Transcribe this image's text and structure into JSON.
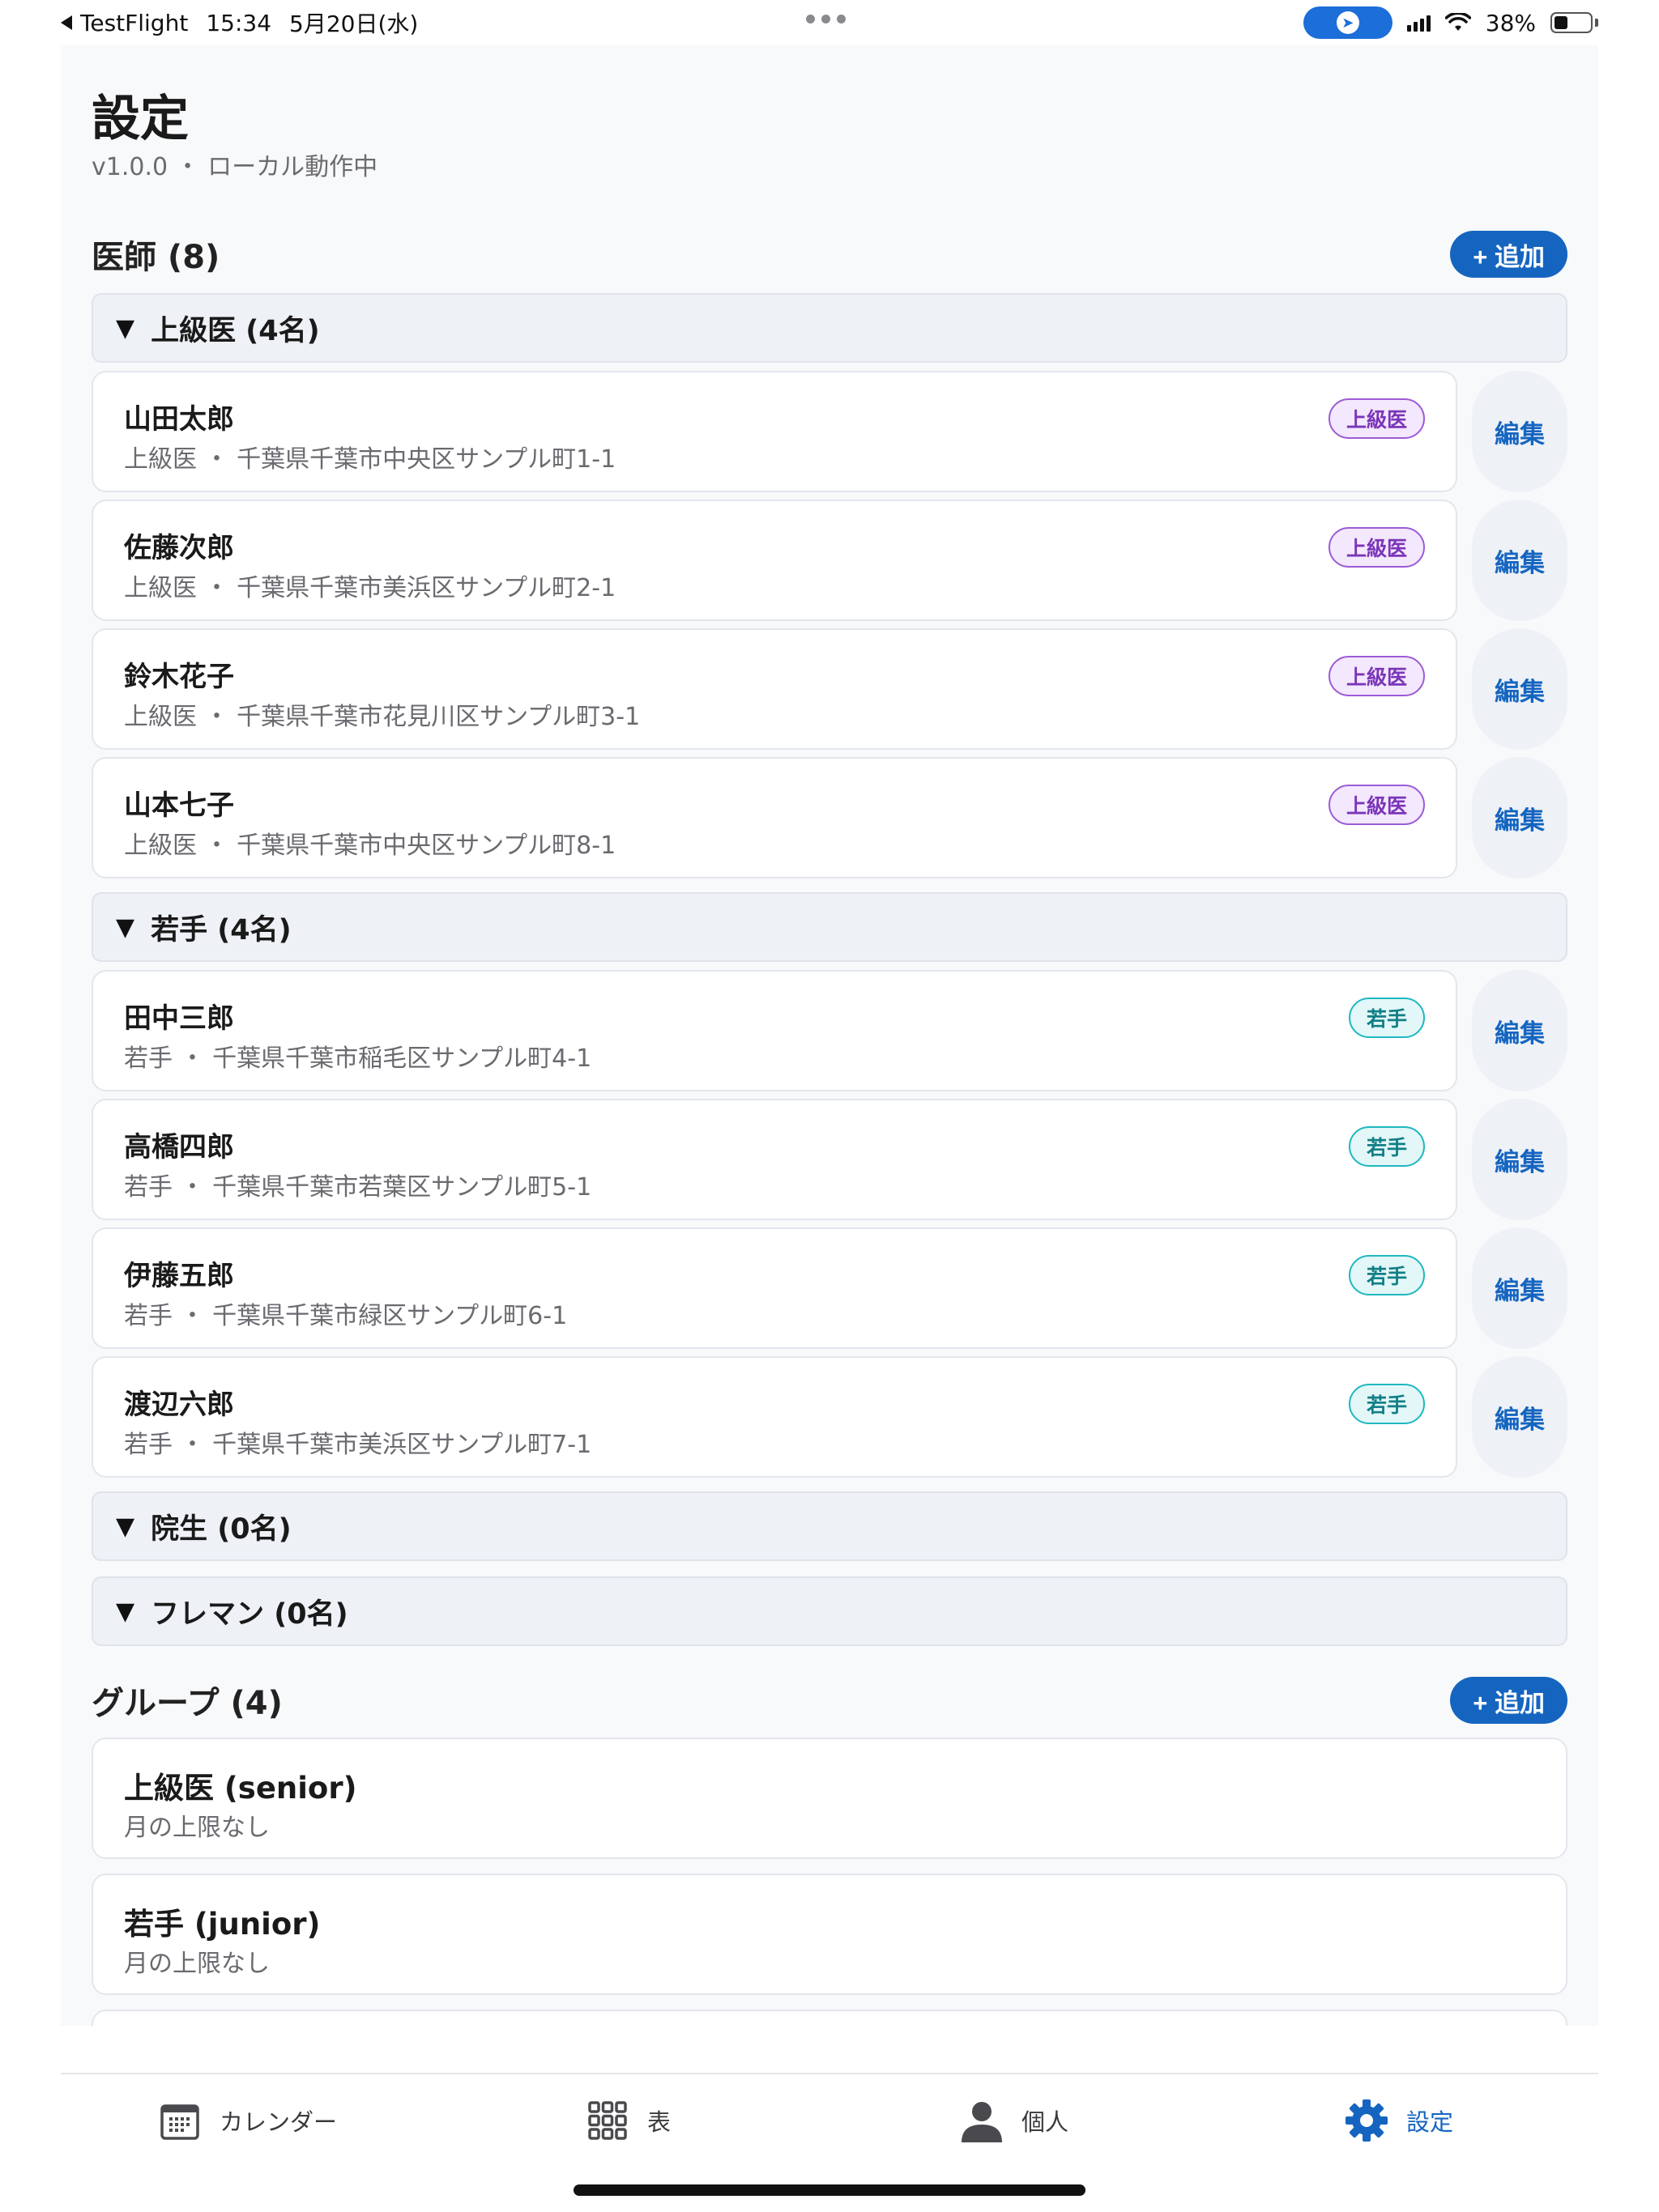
{
  "status_bar": {
    "back_app": "TestFlight",
    "time": "15:34",
    "date": "5月20日(水)",
    "battery": "38%",
    "battery_level": 0.38
  },
  "header": {
    "title": "設定",
    "subtitle": "v1.0.0 ・ ローカル動作中"
  },
  "doctors_section": {
    "title": "医師 (8)",
    "add_label": "+ 追加",
    "groups": [
      {
        "label": "上級医 (4名)",
        "caret": "▼",
        "members": [
          {
            "name": "山田太郎",
            "sub": "上級医 ・ 千葉県千葉市中央区サンプル町1-1",
            "badge": "上級医",
            "edit": "編集"
          },
          {
            "name": "佐藤次郎",
            "sub": "上級医 ・ 千葉県千葉市美浜区サンプル町2-1",
            "badge": "上級医",
            "edit": "編集"
          },
          {
            "name": "鈴木花子",
            "sub": "上級医 ・ 千葉県千葉市花見川区サンプル町3-1",
            "badge": "上級医",
            "edit": "編集"
          },
          {
            "name": "山本七子",
            "sub": "上級医 ・ 千葉県千葉市中央区サンプル町8-1",
            "badge": "上級医",
            "edit": "編集"
          }
        ]
      },
      {
        "label": "若手 (4名)",
        "caret": "▼",
        "members": [
          {
            "name": "田中三郎",
            "sub": "若手 ・ 千葉県千葉市稲毛区サンプル町4-1",
            "badge": "若手",
            "edit": "編集"
          },
          {
            "name": "高橋四郎",
            "sub": "若手 ・ 千葉県千葉市若葉区サンプル町5-1",
            "badge": "若手",
            "edit": "編集"
          },
          {
            "name": "伊藤五郎",
            "sub": "若手 ・ 千葉県千葉市緑区サンプル町6-1",
            "badge": "若手",
            "edit": "編集"
          },
          {
            "name": "渡辺六郎",
            "sub": "若手 ・ 千葉県千葉市美浜区サンプル町7-1",
            "badge": "若手",
            "edit": "編集"
          }
        ]
      },
      {
        "label": "院生 (0名)",
        "caret": "▼",
        "members": []
      },
      {
        "label": "フレマン (0名)",
        "caret": "▼",
        "members": []
      }
    ]
  },
  "groups_section": {
    "title": "グループ (4)",
    "add_label": "+ 追加",
    "items": [
      {
        "name": "上級医 (senior)",
        "sub": "月の上限なし"
      },
      {
        "name": "若手 (junior)",
        "sub": "月の上限なし"
      }
    ]
  },
  "tab_bar": {
    "tabs": [
      {
        "label": "カレンダー",
        "icon": "calendar-icon"
      },
      {
        "label": "表",
        "icon": "grid-icon"
      },
      {
        "label": "個人",
        "icon": "person-icon"
      },
      {
        "label": "設定",
        "icon": "gear-icon",
        "active": true
      }
    ]
  },
  "colors": {
    "accent": "#1565c0",
    "senior_badge": "#9c5bd6",
    "junior_badge": "#1eb8c0"
  }
}
